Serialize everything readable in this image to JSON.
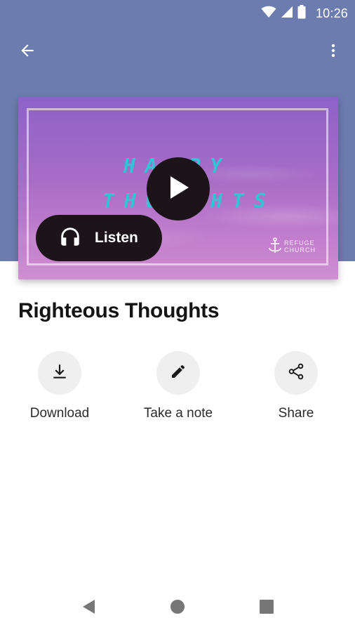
{
  "status_bar": {
    "time": "10:26",
    "icons": [
      "wifi-icon",
      "cell-signal-icon",
      "battery-icon"
    ]
  },
  "toolbar": {
    "back_icon": "arrow-back-icon",
    "more_icon": "more-vertical-icon"
  },
  "cover": {
    "text_line1": "HAPPY",
    "text_line2": "THOUGHTS",
    "logo_text": "REFUGE CHURCH",
    "play_icon": "play-icon"
  },
  "listen": {
    "label": "Listen",
    "icon": "headphones-icon"
  },
  "title": "Righteous Thoughts",
  "actions": [
    {
      "label": "Download",
      "icon": "download-icon"
    },
    {
      "label": "Take a note",
      "icon": "pencil-icon"
    },
    {
      "label": "Share",
      "icon": "share-icon"
    }
  ],
  "nav": {
    "icons": [
      "back-triangle-icon",
      "home-circle-icon",
      "recents-square-icon"
    ]
  },
  "colors": {
    "header": "#6c7caf",
    "button_dark": "#1c1419",
    "cover_text": "#2ec6d6"
  }
}
